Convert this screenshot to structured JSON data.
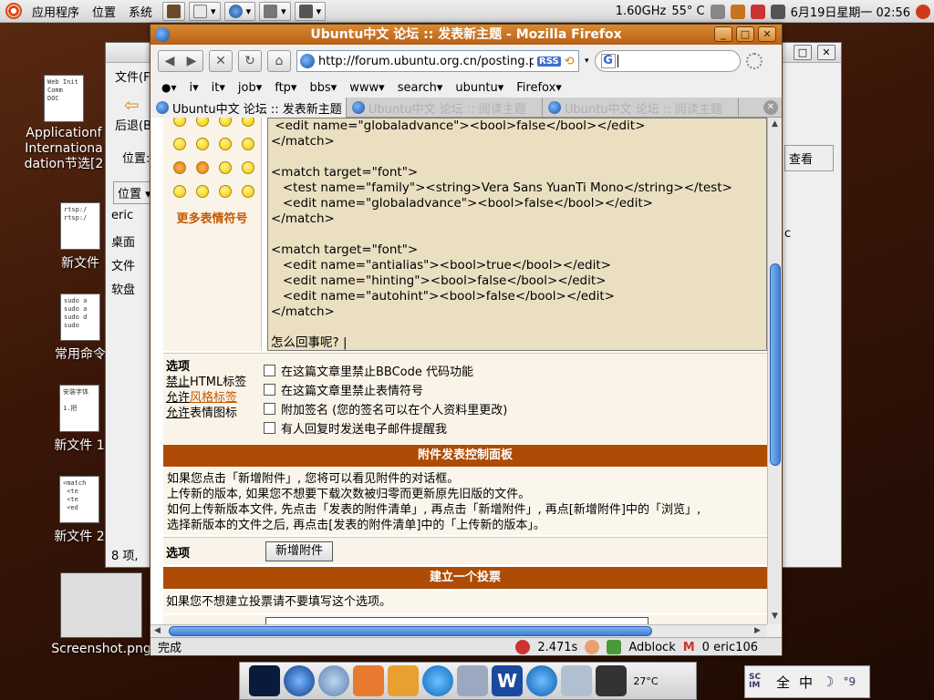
{
  "top_panel": {
    "menus": [
      "应用程序",
      "位置",
      "系统"
    ],
    "cpu": "1.60GHz",
    "temp": "55° C",
    "datetime": "6月19日星期一 02:56"
  },
  "desktop_icons": [
    {
      "label": "Applicationf\nInternationa\ndation节选[2",
      "thumb": "Web Init\nComm\nDOC"
    },
    {
      "label": "新文件",
      "thumb": "rtsp:/\nrtsp:/"
    },
    {
      "label": "常用命令",
      "thumb": "sudo a\nsudo a\nsudo d\nsudo"
    },
    {
      "label": "新文件 1",
      "thumb": "安装字体\n\n1.把"
    },
    {
      "label": "新文件 2",
      "thumb": "<match\n <te\n <te\n <ed"
    },
    {
      "label": "Screenshot.png",
      "thumb": ""
    }
  ],
  "file_manager": {
    "menu_file": "文件(F",
    "back": "后退(B",
    "location": "位置:",
    "places": "位置 ▾",
    "sidebar": [
      "eric",
      "桌面",
      "文件",
      "软盘"
    ],
    "view_as": "查看",
    "status": "8 项,",
    "partial_c": "c"
  },
  "firefox": {
    "title": "Ubuntu中文 论坛 :: 发表新主题 - Mozilla Firefox",
    "url": "http://forum.ubuntu.org.cn/posting.p",
    "rss": "RSS",
    "search_engine": "G",
    "bookmarks": [
      "i▾",
      "it▾",
      "job▾",
      "ftp▾",
      "bbs▾",
      "www▾",
      "search▾",
      "ubuntu▾",
      "Firefox▾"
    ],
    "tabs": [
      {
        "label": "Ubuntu中文 论坛 :: 发表新主题",
        "active": true
      },
      {
        "label": "Ubuntu中文 论坛 :: 阅读主题",
        "active": false
      },
      {
        "label": "Ubuntu中文 论坛 :: 阅读主题",
        "active": false
      }
    ],
    "more_emoticons": "更多表情符号",
    "code_text": " <edit name=\"globaladvance\"><bool>false</bool></edit>\n</match>\n\n<match target=\"font\">\n   <test name=\"family\"><string>Vera Sans YuanTi Mono</string></test>\n   <edit name=\"globaladvance\"><bool>false</bool></edit>\n</match>\n\n<match target=\"font\">\n   <edit name=\"antialias\"><bool>true</bool></edit>\n   <edit name=\"hinting\"><bool>false</bool></edit>\n   <edit name=\"autohint\"><bool>false</bool></edit>\n</match>\n\n怎么回事呢? |",
    "options_label": "选项",
    "html_off": "禁止",
    "html_tag": "HTML标签",
    "allow1": "允许",
    "style_tag": "风格标签",
    "allow2": "允许",
    "emoticon_icon": "表情图标",
    "options": [
      "在这篇文章里禁止BBCode 代码功能",
      "在这篇文章里禁止表情符号",
      "附加签名 (您的签名可以在个人资料里更改)",
      "有人回复时发送电子邮件提醒我"
    ],
    "attach_header": "附件发表控制面板",
    "attach_desc": "如果您点击「新增附件」, 您将可以看见附件的对话框。\n上传新的版本, 如果您不想要下载次数被归零而更新原先旧版的文件。\n如何上传新版本文件, 先点击「发表的附件清单」, 再点击「新增附件」, 再点[新增附件]中的「浏览」,\n选择新版本的文件之后, 再点击[发表的附件清单]中的「上传新的版本」。",
    "attach_label": "选项",
    "add_attach_btn": "新增附件",
    "poll_header": "建立一个投票",
    "poll_desc": "如果您不想建立投票请不要填写这个选项。",
    "status_text": "完成",
    "load_time": "2.471s",
    "adblock": "Adblock",
    "mail": "0 eric106"
  },
  "dock": {
    "temp": "27°C"
  },
  "ime": {
    "full": "全",
    "zh": "中",
    "moon": "☽",
    "dot": "°9"
  },
  "colors": {
    "brown_header": "#ae4b04",
    "code_bg": "#ebdfc2",
    "title_orange": "#c8731f"
  }
}
